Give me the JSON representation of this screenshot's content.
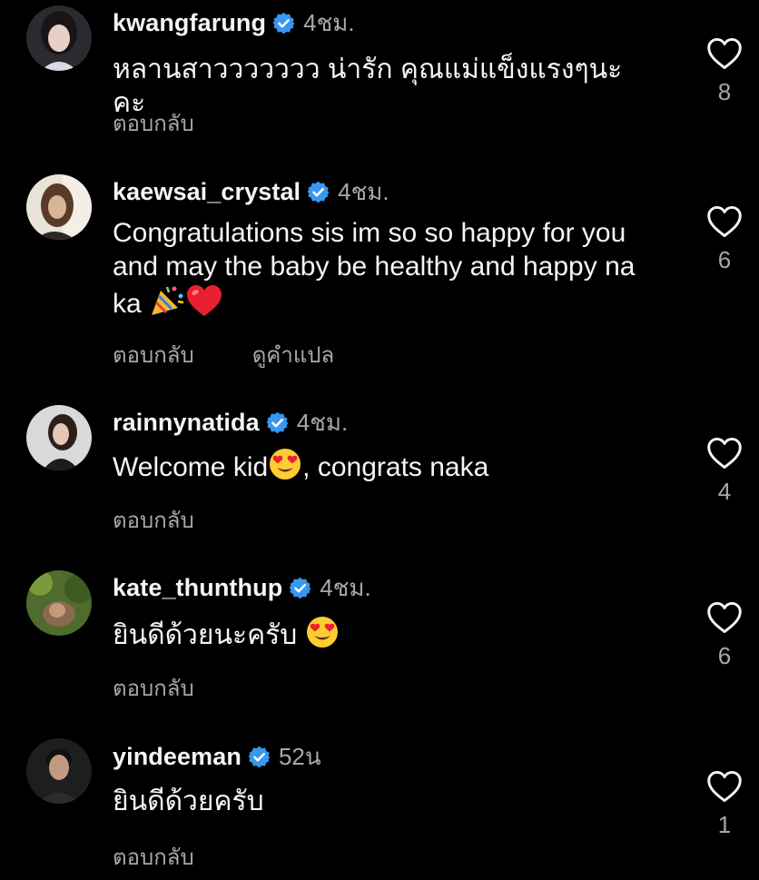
{
  "comments": [
    {
      "username": "kwangfarung",
      "time": "4ชม.",
      "text": "หลานสาววววววว น่ารัก คุณแม่แข็งแรงๆนะคะ",
      "reply_label": "ตอบกลับ",
      "likes": "8"
    },
    {
      "username": "kaewsai_crystal",
      "time": "4ชม.",
      "text": "Congratulations sis im so so happy for you and may the baby be healthy and happy na ka",
      "reply_label": "ตอบกลับ",
      "translate_label": "ดูคำแปล",
      "likes": "6"
    },
    {
      "username": "rainnynatida",
      "time": "4ชม.",
      "text_before": "Welcome kid",
      "text_after": ", congrats naka",
      "reply_label": "ตอบกลับ",
      "likes": "4"
    },
    {
      "username": "kate_thunthup",
      "time": "4ชม.",
      "text": "ยินดีด้วยนะครับ",
      "reply_label": "ตอบกลับ",
      "likes": "6"
    },
    {
      "username": "yindeeman",
      "time": "52น",
      "text": "ยินดีด้วยครับ",
      "reply_label": "ตอบกลับ",
      "likes": "1"
    }
  ],
  "colors": {
    "background": "#000000",
    "text": "#f5f5f5",
    "secondary": "#a8a8a8",
    "verified": "#3897f0"
  },
  "icons": [
    "verified-badge-icon",
    "heart-outline-icon",
    "party-popper-emoji",
    "red-heart-emoji",
    "heart-eyes-emoji"
  ]
}
